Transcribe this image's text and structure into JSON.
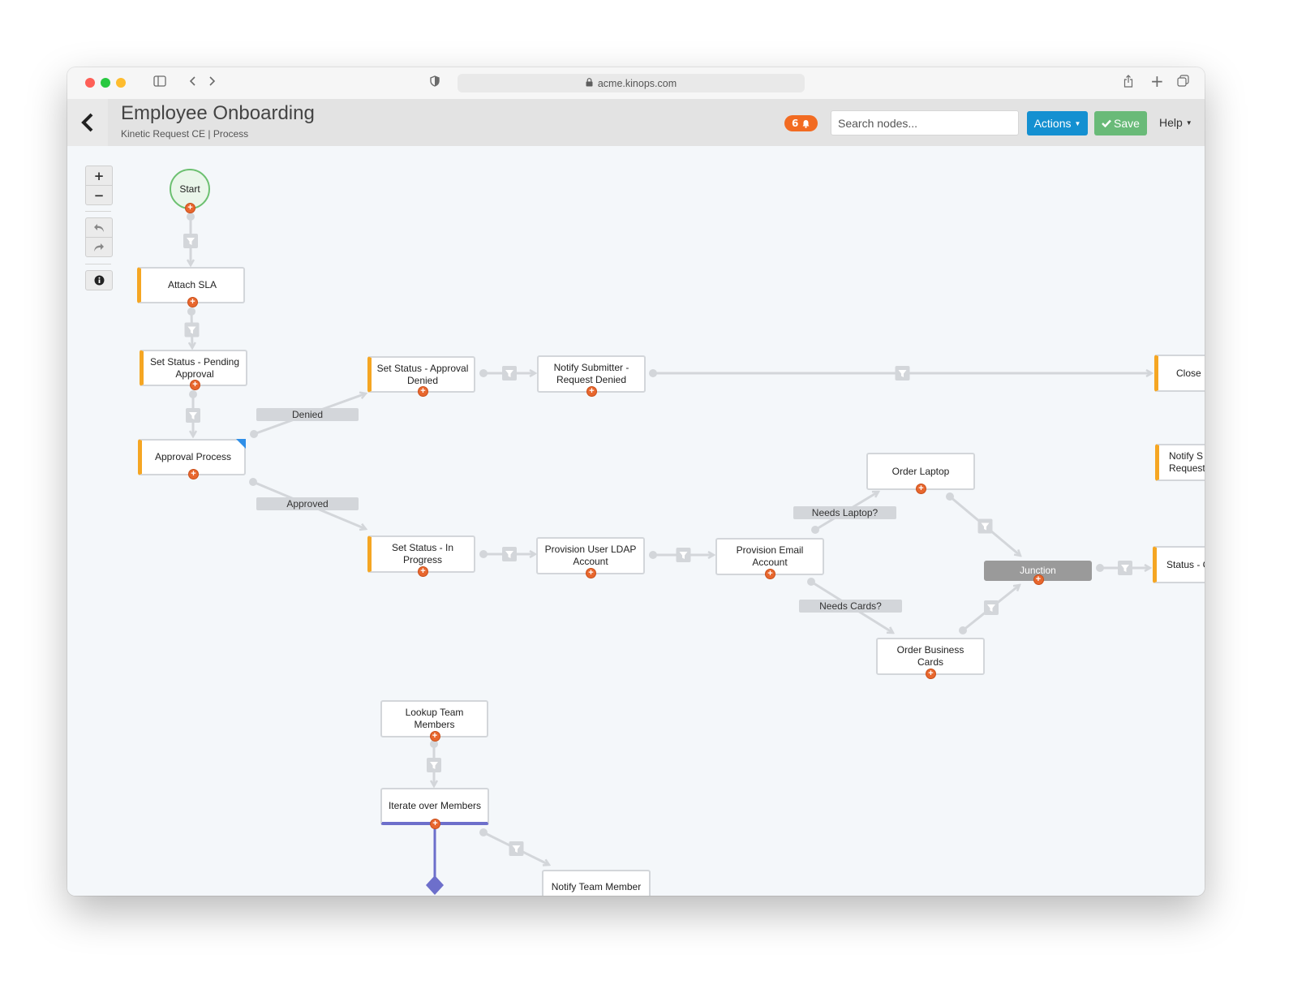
{
  "browser": {
    "url": "acme.kinops.com"
  },
  "app": {
    "title": "Employee Onboarding",
    "subtitle": "Kinetic Request CE | Process",
    "notification_count": "6",
    "search_placeholder": "Search nodes...",
    "actions_label": "Actions",
    "save_label": "Save",
    "help_label": "Help"
  },
  "toolbar": {
    "zoom_in": "+",
    "zoom_out": "−",
    "undo": "↶",
    "redo": "↷",
    "info": "i"
  },
  "nodes": {
    "start": "Start",
    "attach_sla": "Attach SLA",
    "set_status_pending": "Set Status - Pending Approval",
    "approval_process": "Approval Process",
    "set_status_denied": "Set Status - Approval Denied",
    "notify_submitter_denied": "Notify Submitter - Request Denied",
    "close": "Close",
    "notify_submitter_partial": "Notify S Request",
    "set_status_in_progress": "Set Status - In Progress",
    "provision_ldap": "Provision User LDAP Account",
    "provision_email": "Provision Email Account",
    "order_laptop": "Order Laptop",
    "order_business_cards": "Order Business Cards",
    "junction": "Junction",
    "status_partial": "Status - C",
    "lookup_team": "Lookup Team Members",
    "iterate_members": "Iterate over Members",
    "notify_team_member": "Notify Team Member"
  },
  "edge_labels": {
    "denied": "Denied",
    "approved": "Approved",
    "needs_laptop": "Needs Laptop?",
    "needs_cards": "Needs Cards?"
  },
  "colors": {
    "accent_blue": "#1490d1",
    "save_green": "#69ba78",
    "badge_orange": "#f26b22",
    "node_accent": "#f5a623",
    "loop_purple": "#6d6fcb",
    "junction_gray": "#9a9a9a"
  }
}
